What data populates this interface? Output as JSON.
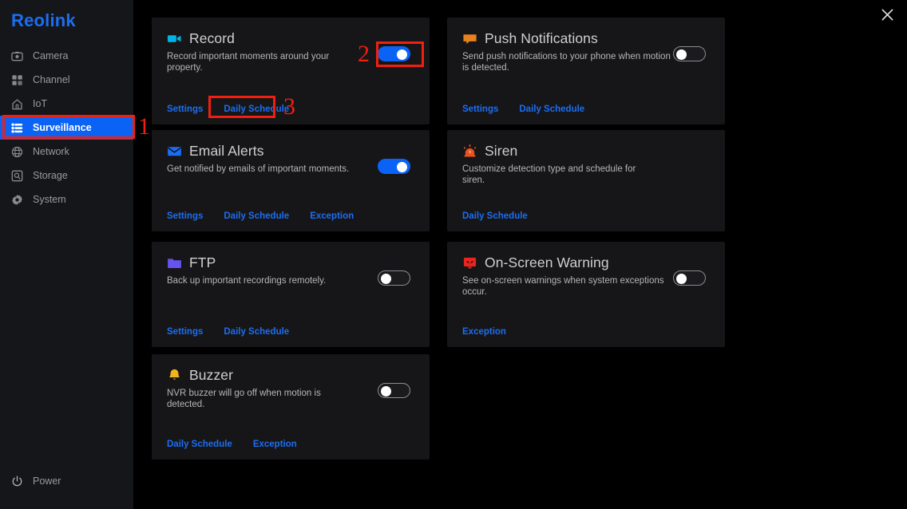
{
  "brand": "Reolink",
  "sidebar": {
    "items": [
      {
        "label": "Camera",
        "icon": "camera-icon",
        "active": false
      },
      {
        "label": "Channel",
        "icon": "grid-icon",
        "active": false
      },
      {
        "label": "IoT",
        "icon": "home-icon",
        "active": false
      },
      {
        "label": "Surveillance",
        "icon": "list-icon",
        "active": true
      },
      {
        "label": "Network",
        "icon": "globe-icon",
        "active": false
      },
      {
        "label": "Storage",
        "icon": "hard-drive-icon",
        "active": false
      },
      {
        "label": "System",
        "icon": "gear-icon",
        "active": false
      }
    ],
    "power": {
      "label": "Power",
      "icon": "power-icon"
    }
  },
  "header": {
    "close_icon": "close-icon",
    "cursor_icon": "mouse-pointer-icon"
  },
  "cards": [
    {
      "title": "Record",
      "icon": "video-camera-icon",
      "icon_color": "#00b5e2",
      "description": "Record important moments around your property.",
      "toggle": {
        "present": true,
        "state": "on"
      },
      "links": [
        "Settings",
        "Daily Schedule"
      ]
    },
    {
      "title": "Push Notifications",
      "icon": "speech-bubble-icon",
      "icon_color": "#e8821e",
      "description": "Send push notifications to your phone when motion is detected.",
      "toggle": {
        "present": true,
        "state": "off"
      },
      "links": [
        "Settings",
        "Daily Schedule"
      ]
    },
    {
      "title": "Email Alerts",
      "icon": "envelope-icon",
      "icon_color": "#1b6ef3",
      "description": "Get notified by emails of important moments.",
      "toggle": {
        "present": true,
        "state": "on"
      },
      "links": [
        "Settings",
        "Daily Schedule",
        "Exception"
      ]
    },
    {
      "title": "Siren",
      "icon": "siren-icon",
      "icon_color": "#e8521e",
      "description": "Customize detection type and schedule for siren.",
      "toggle": {
        "present": false,
        "state": "none"
      },
      "links": [
        "Daily Schedule"
      ]
    },
    {
      "title": "FTP",
      "icon": "folder-icon",
      "icon_color": "#6554f0",
      "description": "Back up important recordings remotely.",
      "toggle": {
        "present": true,
        "state": "off"
      },
      "links": [
        "Settings",
        "Daily Schedule"
      ]
    },
    {
      "title": "On-Screen Warning",
      "icon": "monitor-warning-icon",
      "icon_color": "#e8251e",
      "description": "See on-screen warnings when system exceptions occur.",
      "toggle": {
        "present": true,
        "state": "off"
      },
      "links": [
        "Exception"
      ]
    },
    {
      "title": "Buzzer",
      "icon": "bell-icon",
      "icon_color": "#f0b41e",
      "description": "NVR buzzer will go off when motion is detected.",
      "toggle": {
        "present": true,
        "state": "off"
      },
      "links": [
        "Daily Schedule",
        "Exception"
      ]
    }
  ],
  "annotations": {
    "color": "#f01f0f",
    "steps": [
      {
        "number": "1",
        "target": "sidebar-item-surveillance"
      },
      {
        "number": "2",
        "target": "record-toggle"
      },
      {
        "number": "3",
        "target": "record-daily-schedule-link"
      }
    ]
  }
}
